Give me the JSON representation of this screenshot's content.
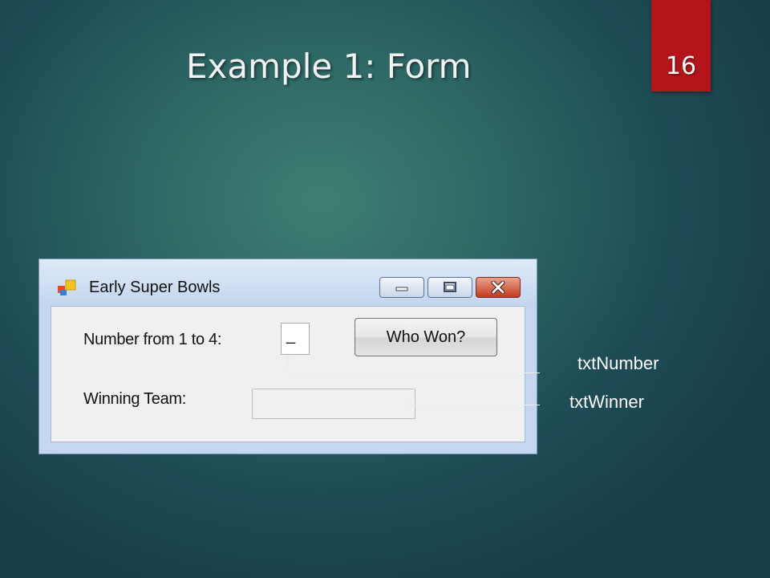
{
  "slide": {
    "title": "Example 1: Form",
    "page_number": "16",
    "accent_color": "#b3151a"
  },
  "window": {
    "title": "Early Super Bowls",
    "icon": "windows-form-icon",
    "controls": [
      "minimize-icon",
      "maximize-icon",
      "close-icon"
    ]
  },
  "form": {
    "number_label": "Number from 1 to 4:",
    "number_value": "_",
    "button_label": "Who Won?",
    "winner_label": "Winning Team:",
    "winner_value": ""
  },
  "callouts": {
    "number": "txtNumber",
    "winner": "txtWinner"
  }
}
